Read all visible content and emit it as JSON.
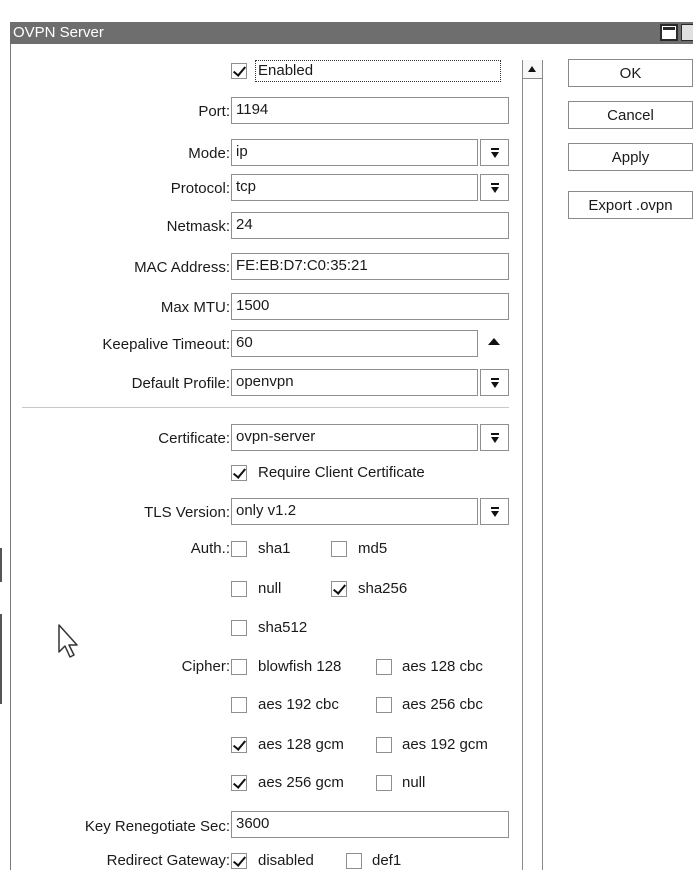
{
  "window": {
    "title": "OVPN Server"
  },
  "buttons": {
    "ok": "OK",
    "cancel": "Cancel",
    "apply": "Apply",
    "export": "Export .ovpn"
  },
  "general": {
    "enabled_label": "Enabled",
    "enabled": true,
    "port_label": "Port:",
    "port": "1194",
    "mode_label": "Mode:",
    "mode": "ip",
    "protocol_label": "Protocol:",
    "protocol": "tcp",
    "netmask_label": "Netmask:",
    "netmask": "24",
    "mac_label": "MAC Address:",
    "mac": "FE:EB:D7:C0:35:21",
    "mtu_label": "Max MTU:",
    "mtu": "1500",
    "keepalive_label": "Keepalive Timeout:",
    "keepalive": "60",
    "profile_label": "Default Profile:",
    "profile": "openvpn"
  },
  "security": {
    "certificate_label": "Certificate:",
    "certificate": "ovpn-server",
    "require_client_cert_label": "Require Client Certificate",
    "require_client_cert": true,
    "tls_label": "TLS Version:",
    "tls": "only v1.2",
    "auth_label": "Auth.:",
    "auth": [
      {
        "name": "sha1",
        "checked": false
      },
      {
        "name": "md5",
        "checked": false
      },
      {
        "name": "null",
        "checked": false
      },
      {
        "name": "sha256",
        "checked": true
      },
      {
        "name": "sha512",
        "checked": false
      }
    ],
    "cipher_label": "Cipher:",
    "cipher": [
      {
        "name": "blowfish 128",
        "checked": false
      },
      {
        "name": "aes 128 cbc",
        "checked": false
      },
      {
        "name": "aes 192 cbc",
        "checked": false
      },
      {
        "name": "aes 256 cbc",
        "checked": false
      },
      {
        "name": "aes 128 gcm",
        "checked": true
      },
      {
        "name": "aes 192 gcm",
        "checked": false
      },
      {
        "name": "aes 256 gcm",
        "checked": true
      },
      {
        "name": "null",
        "checked": false
      }
    ],
    "renegotiate_label": "Key Renegotiate Sec:",
    "renegotiate": "3600",
    "redirect_label": "Redirect Gateway:",
    "redirect": [
      {
        "name": "disabled",
        "checked": true
      },
      {
        "name": "def1",
        "checked": false
      }
    ]
  }
}
